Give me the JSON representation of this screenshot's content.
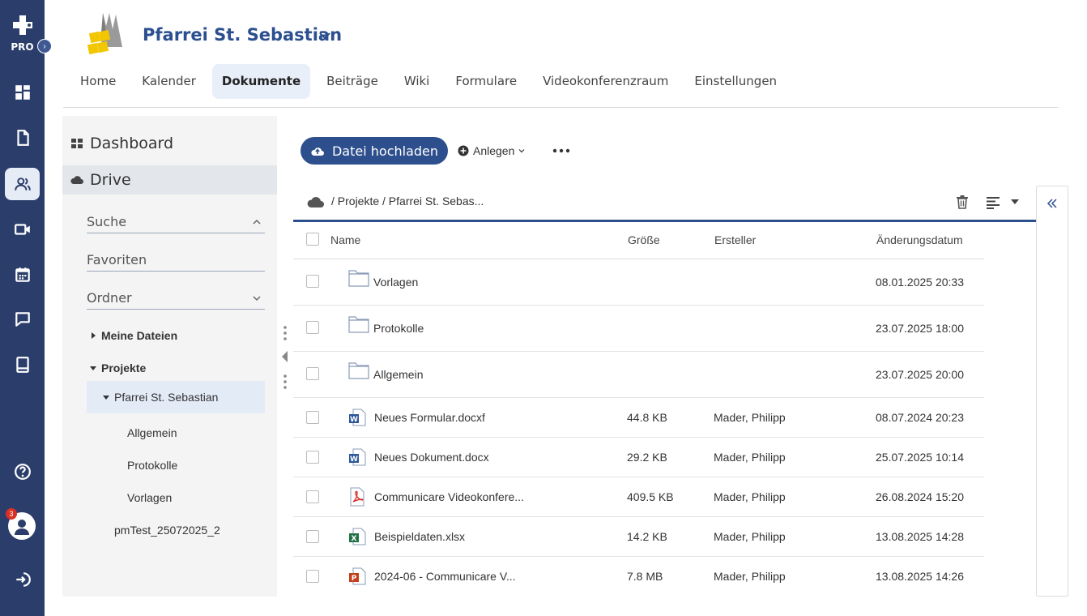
{
  "rail": {
    "pro_label": "PRO",
    "expander_icon": "chevron-right-icon",
    "items": [
      {
        "icon": "dashboard-icon"
      },
      {
        "icon": "document-icon"
      },
      {
        "icon": "users-icon",
        "active": true
      },
      {
        "icon": "video-icon"
      },
      {
        "icon": "calendar-icon"
      },
      {
        "icon": "chat-icon"
      },
      {
        "icon": "book-icon"
      }
    ],
    "help_icon": "help-icon",
    "notification_count": "3",
    "logout_icon": "logout-icon"
  },
  "header": {
    "org_name": "Pfarrei St. Sebastian",
    "tabs": [
      {
        "label": "Home"
      },
      {
        "label": "Kalender"
      },
      {
        "label": "Dokumente",
        "active": true
      },
      {
        "label": "Beiträge"
      },
      {
        "label": "Wiki"
      },
      {
        "label": "Formulare"
      },
      {
        "label": "Videokonferenzraum"
      },
      {
        "label": "Einstellungen"
      }
    ]
  },
  "sidebar": {
    "dashboard_label": "Dashboard",
    "drive_label": "Drive",
    "search_label": "Suche",
    "favorites_label": "Favoriten",
    "folders_label": "Ordner",
    "tree": {
      "meine_dateien": "Meine Dateien",
      "projekte": "Projekte",
      "pfarrei": "Pfarrei St. Sebastian",
      "allgemein": "Allgemein",
      "protokolle": "Protokolle",
      "vorlagen": "Vorlagen",
      "pmtest": "pmTest_25072025_2"
    }
  },
  "toolbar": {
    "upload_label": "Datei hochladen",
    "create_label": "Anlegen"
  },
  "breadcrumb": {
    "path": "/ Projekte / Pfarrei St. Sebas..."
  },
  "table": {
    "headers": {
      "name": "Name",
      "size": "Größe",
      "creator": "Ersteller",
      "modified": "Änderungsdatum"
    },
    "rows": [
      {
        "type": "folder",
        "name": "Vorlagen",
        "size": "",
        "creator": "",
        "modified": "08.01.2025 20:33"
      },
      {
        "type": "folder",
        "name": "Protokolle",
        "size": "",
        "creator": "",
        "modified": "23.07.2025 18:00"
      },
      {
        "type": "folder",
        "name": "Allgemein",
        "size": "",
        "creator": "",
        "modified": "23.07.2025 20:00"
      },
      {
        "type": "word",
        "name": "Neues Formular.docxf",
        "size": "44.8 KB",
        "creator": "Mader, Philipp",
        "modified": "08.07.2024 20:23"
      },
      {
        "type": "word",
        "name": "Neues Dokument.docx",
        "size": "29.2 KB",
        "creator": "Mader, Philipp",
        "modified": "25.07.2025 10:14"
      },
      {
        "type": "pdf",
        "name": "Communicare Videokonfere...",
        "size": "409.5 KB",
        "creator": "Mader, Philipp",
        "modified": "26.08.2024 15:20"
      },
      {
        "type": "excel",
        "name": "Beispieldaten.xlsx",
        "size": "14.2 KB",
        "creator": "Mader, Philipp",
        "modified": "13.08.2025 14:28"
      },
      {
        "type": "powerpoint",
        "name": "2024-06 - Communicare V...",
        "size": "7.8 MB",
        "creator": "Mader, Philipp",
        "modified": "13.08.2025 14:26"
      }
    ]
  },
  "colors": {
    "rail_bg": "#2b3e6b",
    "accent": "#2e4f8d",
    "title": "#2b4f8f",
    "word": "#2b579a",
    "excel": "#217346",
    "pdf": "#d9302c",
    "powerpoint": "#c43e1c"
  }
}
